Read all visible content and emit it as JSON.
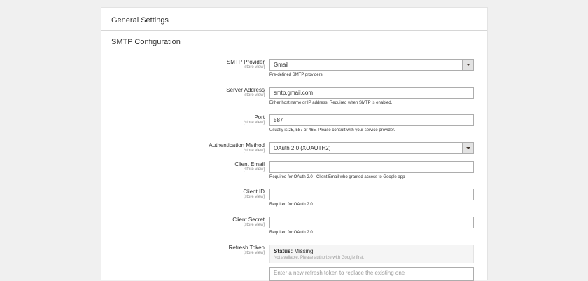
{
  "page": {
    "section_title": "General Settings",
    "subsection_title": "SMTP Configuration"
  },
  "fields": {
    "smtp_provider": {
      "label": "SMTP Provider",
      "scope": "[store view]",
      "value": "Gmail",
      "note": "Pre-defined SMTP providers"
    },
    "server_address": {
      "label": "Server Address",
      "scope": "[store view]",
      "value": "smtp.gmail.com",
      "note": "Either host name or IP address. Required when SMTP is enabled."
    },
    "port": {
      "label": "Port",
      "scope": "[store view]",
      "value": "587",
      "note": "Usually is 25, 587 or 465. Please consult with your service provider."
    },
    "auth_method": {
      "label": "Authentication Method",
      "scope": "[store view]",
      "value": "OAuth 2.0 (XOAUTH2)"
    },
    "client_email": {
      "label": "Client Email",
      "scope": "[store view]",
      "value": "",
      "note": "Required for OAuth 2.0 - Client Email who granted access to Google app"
    },
    "client_id": {
      "label": "Client ID",
      "scope": "[store view]",
      "value": "",
      "note": "Required for OAuth 2.0"
    },
    "client_secret": {
      "label": "Client Secret",
      "scope": "[store view]",
      "value": "",
      "note": "Required for OAuth 2.0"
    },
    "refresh_token": {
      "label": "Refresh Token",
      "scope": "[store view]",
      "status_label": "Status:",
      "status_value": "Missing",
      "status_note": "Not available. Please authorize with Google first.",
      "placeholder": "Enter a new refresh token to replace the existing one"
    }
  }
}
